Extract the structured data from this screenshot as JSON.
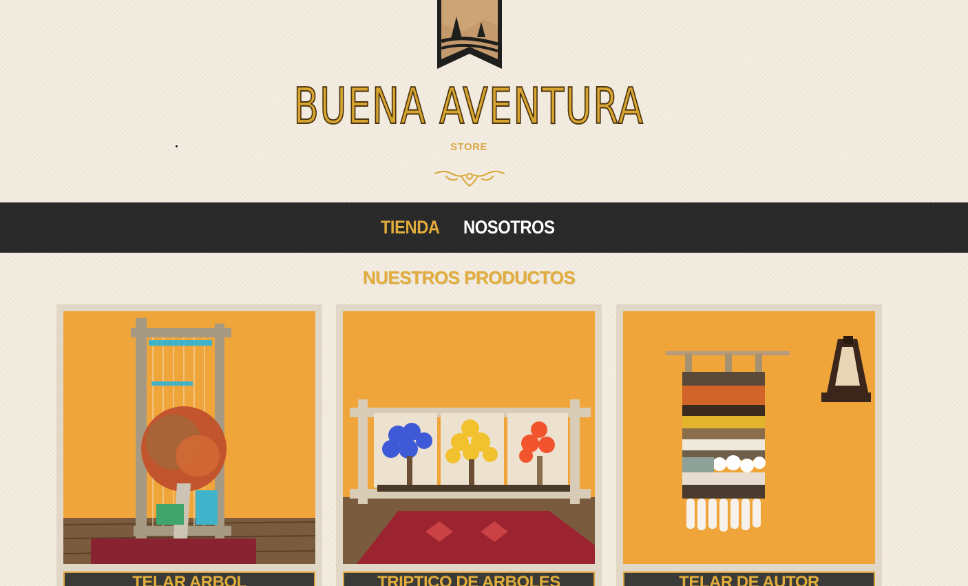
{
  "brand": {
    "title": "BUENA AVENTURA",
    "subtitle": "STORE"
  },
  "nav": {
    "items": [
      {
        "label": "TIENDA",
        "active": true
      },
      {
        "label": "NOSOTROS",
        "active": false
      }
    ]
  },
  "section": {
    "title": "NUESTROS PRODUCTOS"
  },
  "products": [
    {
      "name": "TELAR ARBOL"
    },
    {
      "name": "TRIPTICO DE ARBOLES"
    },
    {
      "name": "TELAR DE AUTOR"
    }
  ],
  "colors": {
    "accent": "#e3ad3b",
    "navbar": "#2a2a2a",
    "background": "#f4ede2",
    "card_frame": "#e1d7c7"
  }
}
